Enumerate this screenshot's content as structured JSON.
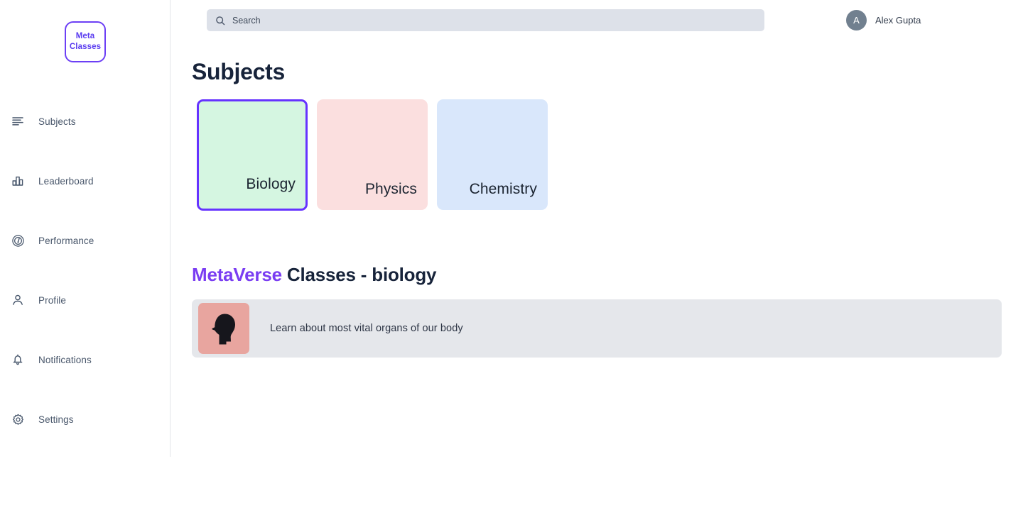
{
  "brand": {
    "logo_line1": "Meta",
    "logo_line2": "Classes",
    "accent_color": "#6633ff",
    "brand_text_color": "#7a3df2"
  },
  "sidebar": {
    "items": [
      {
        "label": "Subjects",
        "icon": "list-lines-icon"
      },
      {
        "label": "Leaderboard",
        "icon": "bar-chart-icon"
      },
      {
        "label": "Performance",
        "icon": "gauge-icon"
      },
      {
        "label": "Profile",
        "icon": "person-icon"
      },
      {
        "label": "Notifications",
        "icon": "bell-icon"
      },
      {
        "label": "Settings",
        "icon": "gear-icon"
      }
    ]
  },
  "topbar": {
    "search": {
      "value": "",
      "placeholder": "Search",
      "icon": "search-icon"
    },
    "user": {
      "initial": "A",
      "name": "Alex Gupta"
    }
  },
  "main": {
    "page_title": "Subjects",
    "subjects": [
      {
        "label": "Biology",
        "color": "#d5f6e1",
        "selected": true
      },
      {
        "label": "Physics",
        "color": "#fbdfdf",
        "selected": false
      },
      {
        "label": "Chemistry",
        "color": "#d9e7fb",
        "selected": false
      }
    ],
    "section": {
      "brand_word": "MetaVerse",
      "rest": " Classes - biology"
    },
    "classes": [
      {
        "title": "Learn about most vital organs of our body",
        "thumb_color": "#e8a59f",
        "thumb_icon": "head-silhouette-icon"
      }
    ]
  }
}
